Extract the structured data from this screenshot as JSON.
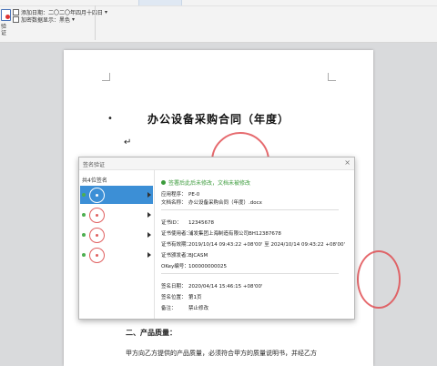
{
  "ribbon": {
    "verify_button": "验证",
    "timestamp_option": "添加日期：二〇二〇年四月十四日",
    "show_sign_option": "加密数据显示：黑色"
  },
  "document": {
    "title": "办公设备采购合同（年度）",
    "section_heading": "二、产品质量：",
    "paragraph": "甲方向乙方提供的产品质量，必须符合甲方的质量说明书，并经乙方"
  },
  "dialog": {
    "title": "签名验证",
    "close_glyph": "×",
    "list_header": "共4位签名",
    "status": "签署后此后未修改，文档未被修改",
    "app_label": "应用程序：",
    "app_value": "PE-0",
    "doc_label": "文档名称：",
    "doc_value": "办公设备采购合同（年度）.docx",
    "cert_id_label": "证书ID：",
    "cert_id_value": "12345678",
    "owner_label": "证书使用者：",
    "owner_value": "浦发集团上海制造有限公司BH12387678",
    "validity_label": "证书有效期：",
    "validity_value": "2019/10/14 09:43:22 +08'00'  至  2024/10/14 09:43:22 +08'00'",
    "issuer_label": "证书颁发者：",
    "issuer_value": "BJCASM",
    "key_label": "OKey编号：",
    "key_value": "100000000025",
    "sign_date_label": "签名日期：",
    "sign_date_value": "2020/04/14 15:46:15 +08'00'",
    "pos_label": "签名位置：",
    "pos_value": "第1页",
    "reason_label": "备注：",
    "reason_value": "禁止修改"
  },
  "colors": {
    "stamp": "#e0454a",
    "selection": "#3c8fd6",
    "ok": "#3b9b3b"
  }
}
